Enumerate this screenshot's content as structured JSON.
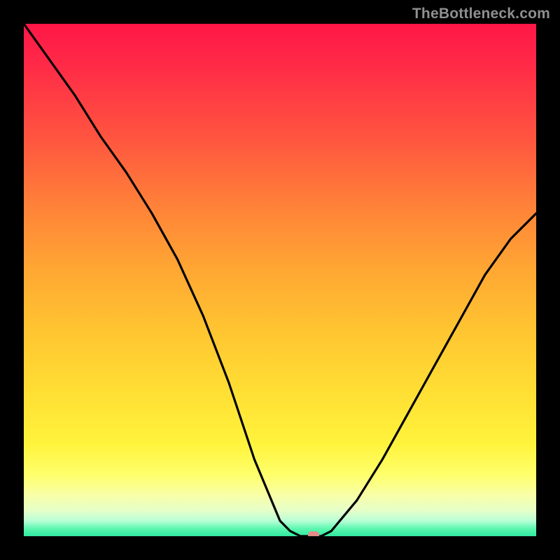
{
  "watermark": "TheBottleneck.com",
  "marker": {
    "x_pct": 56.5,
    "y_pct": 0
  },
  "chart_data": {
    "type": "line",
    "title": "",
    "xlabel": "",
    "ylabel": "",
    "xlim": [
      0,
      100
    ],
    "ylim": [
      0,
      100
    ],
    "grid": false,
    "legend": false,
    "series": [
      {
        "name": "bottleneck-curve",
        "x": [
          0,
          5,
          10,
          15,
          20,
          25,
          30,
          35,
          40,
          45,
          50,
          52,
          54,
          56,
          58,
          60,
          65,
          70,
          75,
          80,
          85,
          90,
          95,
          100
        ],
        "y": [
          100,
          93,
          86,
          78,
          71,
          63,
          54,
          43,
          30,
          15,
          3,
          1,
          0,
          0,
          0,
          1,
          7,
          15,
          24,
          33,
          42,
          51,
          58,
          63
        ]
      }
    ],
    "background_gradient_stops": [
      {
        "pct": 0,
        "color": "#ff1747"
      },
      {
        "pct": 8,
        "color": "#ff2a47"
      },
      {
        "pct": 22,
        "color": "#ff5440"
      },
      {
        "pct": 36,
        "color": "#ff8338"
      },
      {
        "pct": 48,
        "color": "#ffa733"
      },
      {
        "pct": 60,
        "color": "#ffc531"
      },
      {
        "pct": 72,
        "color": "#ffdf34"
      },
      {
        "pct": 82,
        "color": "#fff33c"
      },
      {
        "pct": 88,
        "color": "#feff6b"
      },
      {
        "pct": 92,
        "color": "#f8ffa7"
      },
      {
        "pct": 95,
        "color": "#e6ffc9"
      },
      {
        "pct": 97,
        "color": "#b8ffd6"
      },
      {
        "pct": 98.5,
        "color": "#5ef7b0"
      },
      {
        "pct": 100,
        "color": "#30e99f"
      }
    ],
    "annotations": [
      {
        "name": "optimal-marker",
        "x": 56.5,
        "y": 0
      }
    ]
  }
}
